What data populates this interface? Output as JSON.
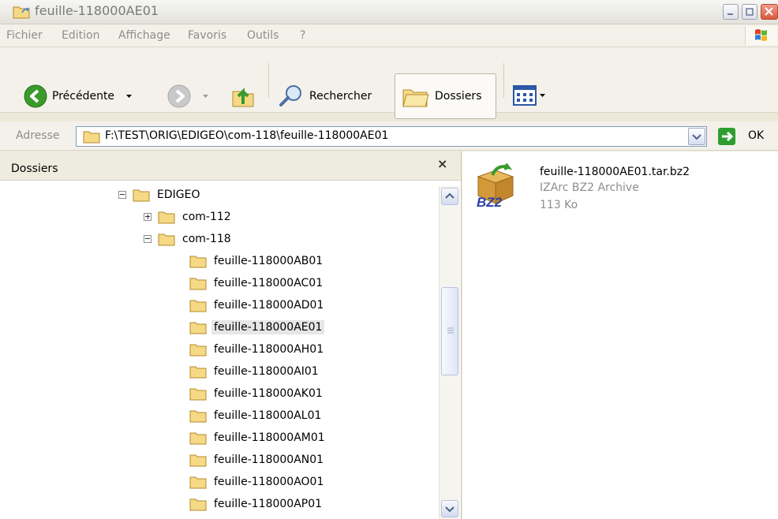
{
  "window": {
    "title": "feuille-118000AE01"
  },
  "menu": [
    "Fichier",
    "Edition",
    "Affichage",
    "Favoris",
    "Outils",
    "?"
  ],
  "toolbar": {
    "back_label": "Précédente",
    "search_label": "Rechercher",
    "folders_label": "Dossiers"
  },
  "address": {
    "label": "Adresse",
    "path": "F:\\TEST\\ORIG\\EDIGEO\\com-118\\feuille-118000AE01",
    "go_label": "OK"
  },
  "folders_pane": {
    "title": "Dossiers",
    "close_glyph": "×",
    "nodes": [
      {
        "label": "EDIGEO",
        "expander": "collapse"
      },
      {
        "label": "com-112",
        "expander": "expand"
      },
      {
        "label": "com-118",
        "expander": "collapse"
      },
      {
        "label": "feuille-118000AB01"
      },
      {
        "label": "feuille-118000AC01"
      },
      {
        "label": "feuille-118000AD01"
      },
      {
        "label": "feuille-118000AE01",
        "selected": true
      },
      {
        "label": "feuille-118000AH01"
      },
      {
        "label": "feuille-118000AI01"
      },
      {
        "label": "feuille-118000AK01"
      },
      {
        "label": "feuille-118000AL01"
      },
      {
        "label": "feuille-118000AM01"
      },
      {
        "label": "feuille-118000AN01"
      },
      {
        "label": "feuille-118000AO01"
      },
      {
        "label": "feuille-118000AP01"
      }
    ]
  },
  "file": {
    "name": "feuille-118000AE01.tar.bz2",
    "type": "IZArc BZ2 Archive",
    "size": "113 Ko",
    "icon_text": "BZ2"
  },
  "colors": {
    "folder_fill": "#f5d985",
    "back_green": "#3a9a2c",
    "go_green": "#2f9e2f",
    "selection": "#e6e6e6"
  }
}
